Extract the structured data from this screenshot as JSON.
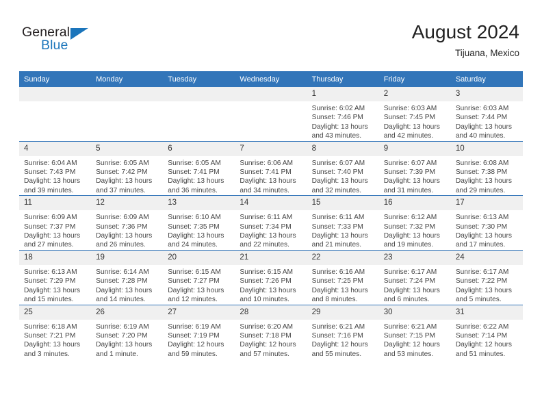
{
  "brand": {
    "name_part1": "General",
    "name_part2": "Blue",
    "triangle_color": "#1b75bb"
  },
  "header": {
    "title": "August 2024",
    "subtitle": "Tijuana, Mexico",
    "accent_color": "#3275b9"
  },
  "weekday_headers": [
    "Sunday",
    "Monday",
    "Tuesday",
    "Wednesday",
    "Thursday",
    "Friday",
    "Saturday"
  ],
  "weeks": [
    [
      {
        "day": "",
        "empty": true,
        "sunrise": "",
        "sunset": "",
        "daylight1": "",
        "daylight2": ""
      },
      {
        "day": "",
        "empty": true,
        "sunrise": "",
        "sunset": "",
        "daylight1": "",
        "daylight2": ""
      },
      {
        "day": "",
        "empty": true,
        "sunrise": "",
        "sunset": "",
        "daylight1": "",
        "daylight2": ""
      },
      {
        "day": "",
        "empty": true,
        "sunrise": "",
        "sunset": "",
        "daylight1": "",
        "daylight2": ""
      },
      {
        "day": "1",
        "empty": false,
        "sunrise": "Sunrise: 6:02 AM",
        "sunset": "Sunset: 7:46 PM",
        "daylight1": "Daylight: 13 hours",
        "daylight2": "and 43 minutes."
      },
      {
        "day": "2",
        "empty": false,
        "sunrise": "Sunrise: 6:03 AM",
        "sunset": "Sunset: 7:45 PM",
        "daylight1": "Daylight: 13 hours",
        "daylight2": "and 42 minutes."
      },
      {
        "day": "3",
        "empty": false,
        "sunrise": "Sunrise: 6:03 AM",
        "sunset": "Sunset: 7:44 PM",
        "daylight1": "Daylight: 13 hours",
        "daylight2": "and 40 minutes."
      }
    ],
    [
      {
        "day": "4",
        "empty": false,
        "sunrise": "Sunrise: 6:04 AM",
        "sunset": "Sunset: 7:43 PM",
        "daylight1": "Daylight: 13 hours",
        "daylight2": "and 39 minutes."
      },
      {
        "day": "5",
        "empty": false,
        "sunrise": "Sunrise: 6:05 AM",
        "sunset": "Sunset: 7:42 PM",
        "daylight1": "Daylight: 13 hours",
        "daylight2": "and 37 minutes."
      },
      {
        "day": "6",
        "empty": false,
        "sunrise": "Sunrise: 6:05 AM",
        "sunset": "Sunset: 7:41 PM",
        "daylight1": "Daylight: 13 hours",
        "daylight2": "and 36 minutes."
      },
      {
        "day": "7",
        "empty": false,
        "sunrise": "Sunrise: 6:06 AM",
        "sunset": "Sunset: 7:41 PM",
        "daylight1": "Daylight: 13 hours",
        "daylight2": "and 34 minutes."
      },
      {
        "day": "8",
        "empty": false,
        "sunrise": "Sunrise: 6:07 AM",
        "sunset": "Sunset: 7:40 PM",
        "daylight1": "Daylight: 13 hours",
        "daylight2": "and 32 minutes."
      },
      {
        "day": "9",
        "empty": false,
        "sunrise": "Sunrise: 6:07 AM",
        "sunset": "Sunset: 7:39 PM",
        "daylight1": "Daylight: 13 hours",
        "daylight2": "and 31 minutes."
      },
      {
        "day": "10",
        "empty": false,
        "sunrise": "Sunrise: 6:08 AM",
        "sunset": "Sunset: 7:38 PM",
        "daylight1": "Daylight: 13 hours",
        "daylight2": "and 29 minutes."
      }
    ],
    [
      {
        "day": "11",
        "empty": false,
        "sunrise": "Sunrise: 6:09 AM",
        "sunset": "Sunset: 7:37 PM",
        "daylight1": "Daylight: 13 hours",
        "daylight2": "and 27 minutes."
      },
      {
        "day": "12",
        "empty": false,
        "sunrise": "Sunrise: 6:09 AM",
        "sunset": "Sunset: 7:36 PM",
        "daylight1": "Daylight: 13 hours",
        "daylight2": "and 26 minutes."
      },
      {
        "day": "13",
        "empty": false,
        "sunrise": "Sunrise: 6:10 AM",
        "sunset": "Sunset: 7:35 PM",
        "daylight1": "Daylight: 13 hours",
        "daylight2": "and 24 minutes."
      },
      {
        "day": "14",
        "empty": false,
        "sunrise": "Sunrise: 6:11 AM",
        "sunset": "Sunset: 7:34 PM",
        "daylight1": "Daylight: 13 hours",
        "daylight2": "and 22 minutes."
      },
      {
        "day": "15",
        "empty": false,
        "sunrise": "Sunrise: 6:11 AM",
        "sunset": "Sunset: 7:33 PM",
        "daylight1": "Daylight: 13 hours",
        "daylight2": "and 21 minutes."
      },
      {
        "day": "16",
        "empty": false,
        "sunrise": "Sunrise: 6:12 AM",
        "sunset": "Sunset: 7:32 PM",
        "daylight1": "Daylight: 13 hours",
        "daylight2": "and 19 minutes."
      },
      {
        "day": "17",
        "empty": false,
        "sunrise": "Sunrise: 6:13 AM",
        "sunset": "Sunset: 7:30 PM",
        "daylight1": "Daylight: 13 hours",
        "daylight2": "and 17 minutes."
      }
    ],
    [
      {
        "day": "18",
        "empty": false,
        "sunrise": "Sunrise: 6:13 AM",
        "sunset": "Sunset: 7:29 PM",
        "daylight1": "Daylight: 13 hours",
        "daylight2": "and 15 minutes."
      },
      {
        "day": "19",
        "empty": false,
        "sunrise": "Sunrise: 6:14 AM",
        "sunset": "Sunset: 7:28 PM",
        "daylight1": "Daylight: 13 hours",
        "daylight2": "and 14 minutes."
      },
      {
        "day": "20",
        "empty": false,
        "sunrise": "Sunrise: 6:15 AM",
        "sunset": "Sunset: 7:27 PM",
        "daylight1": "Daylight: 13 hours",
        "daylight2": "and 12 minutes."
      },
      {
        "day": "21",
        "empty": false,
        "sunrise": "Sunrise: 6:15 AM",
        "sunset": "Sunset: 7:26 PM",
        "daylight1": "Daylight: 13 hours",
        "daylight2": "and 10 minutes."
      },
      {
        "day": "22",
        "empty": false,
        "sunrise": "Sunrise: 6:16 AM",
        "sunset": "Sunset: 7:25 PM",
        "daylight1": "Daylight: 13 hours",
        "daylight2": "and 8 minutes."
      },
      {
        "day": "23",
        "empty": false,
        "sunrise": "Sunrise: 6:17 AM",
        "sunset": "Sunset: 7:24 PM",
        "daylight1": "Daylight: 13 hours",
        "daylight2": "and 6 minutes."
      },
      {
        "day": "24",
        "empty": false,
        "sunrise": "Sunrise: 6:17 AM",
        "sunset": "Sunset: 7:22 PM",
        "daylight1": "Daylight: 13 hours",
        "daylight2": "and 5 minutes."
      }
    ],
    [
      {
        "day": "25",
        "empty": false,
        "sunrise": "Sunrise: 6:18 AM",
        "sunset": "Sunset: 7:21 PM",
        "daylight1": "Daylight: 13 hours",
        "daylight2": "and 3 minutes."
      },
      {
        "day": "26",
        "empty": false,
        "sunrise": "Sunrise: 6:19 AM",
        "sunset": "Sunset: 7:20 PM",
        "daylight1": "Daylight: 13 hours",
        "daylight2": "and 1 minute."
      },
      {
        "day": "27",
        "empty": false,
        "sunrise": "Sunrise: 6:19 AM",
        "sunset": "Sunset: 7:19 PM",
        "daylight1": "Daylight: 12 hours",
        "daylight2": "and 59 minutes."
      },
      {
        "day": "28",
        "empty": false,
        "sunrise": "Sunrise: 6:20 AM",
        "sunset": "Sunset: 7:18 PM",
        "daylight1": "Daylight: 12 hours",
        "daylight2": "and 57 minutes."
      },
      {
        "day": "29",
        "empty": false,
        "sunrise": "Sunrise: 6:21 AM",
        "sunset": "Sunset: 7:16 PM",
        "daylight1": "Daylight: 12 hours",
        "daylight2": "and 55 minutes."
      },
      {
        "day": "30",
        "empty": false,
        "sunrise": "Sunrise: 6:21 AM",
        "sunset": "Sunset: 7:15 PM",
        "daylight1": "Daylight: 12 hours",
        "daylight2": "and 53 minutes."
      },
      {
        "day": "31",
        "empty": false,
        "sunrise": "Sunrise: 6:22 AM",
        "sunset": "Sunset: 7:14 PM",
        "daylight1": "Daylight: 12 hours",
        "daylight2": "and 51 minutes."
      }
    ]
  ]
}
